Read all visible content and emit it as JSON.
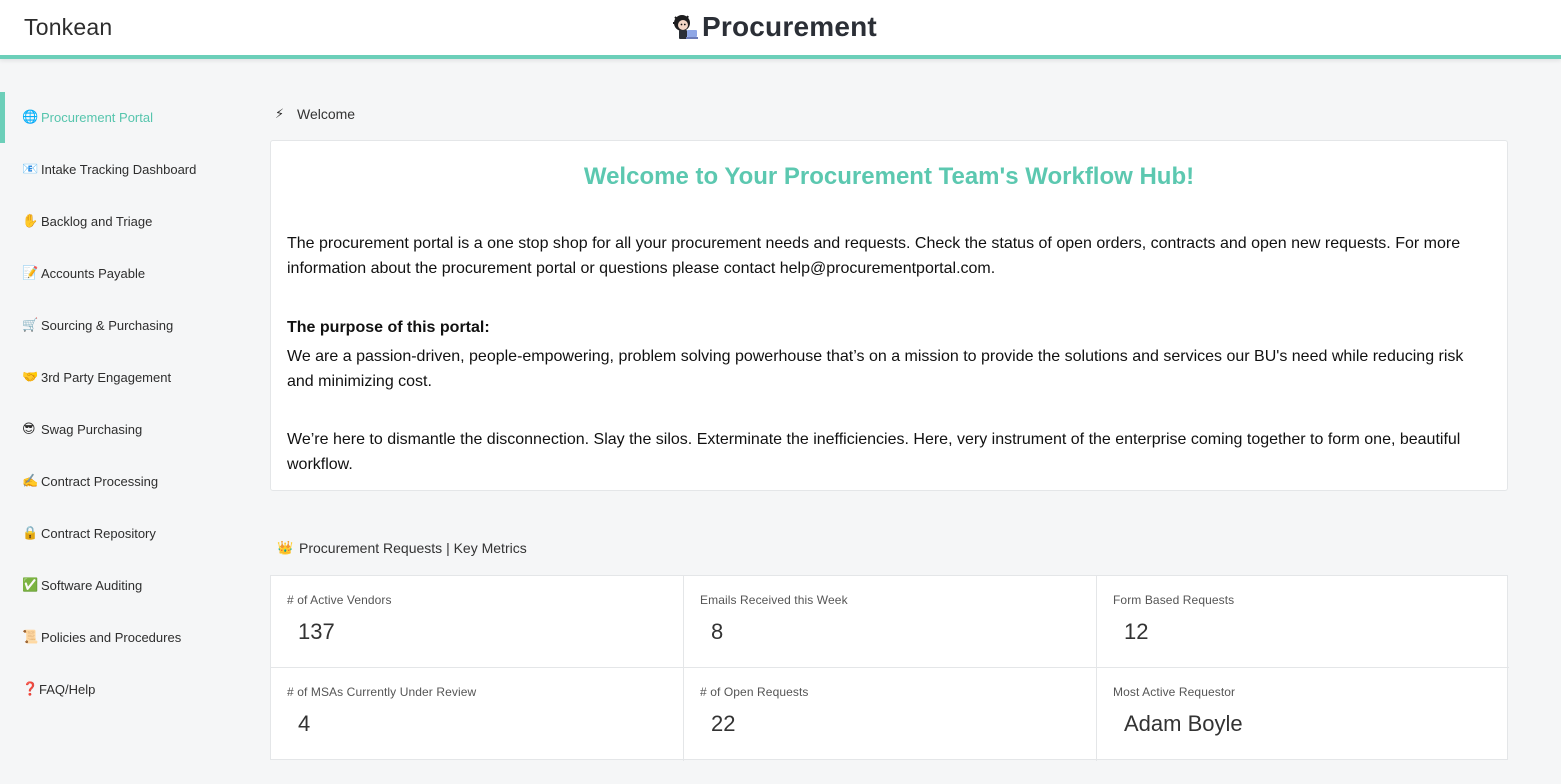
{
  "header": {
    "brand": "Tonkean",
    "app_title": "Procurement"
  },
  "sidebar": {
    "items": [
      {
        "emoji": "🌐",
        "label": "Procurement Portal",
        "active": true
      },
      {
        "emoji": "📧",
        "label": "Intake Tracking Dashboard"
      },
      {
        "emoji": "✋",
        "label": "Backlog and Triage"
      },
      {
        "emoji": "📝",
        "label": "Accounts Payable"
      },
      {
        "emoji": "🛒",
        "label": "Sourcing & Purchasing"
      },
      {
        "emoji": "🤝",
        "label": "3rd Party Engagement"
      },
      {
        "emoji": "😎",
        "label": "Swag Purchasing"
      },
      {
        "emoji": "✍️",
        "label": "Contract Processing"
      },
      {
        "emoji": "🔒",
        "label": "Contract Repository"
      },
      {
        "emoji": "✅",
        "label": "Software Auditing"
      },
      {
        "emoji": "📜",
        "label": "Policies and Procedures"
      },
      {
        "emoji": "❓",
        "label": "FAQ/Help"
      }
    ]
  },
  "welcome_section": {
    "icon": "⚡",
    "title": "Welcome",
    "card_title": "Welcome to Your Procurement Team's Workflow Hub!",
    "paragraph1": "The procurement portal is a one stop shop for all your procurement needs and requests. Check the status of open orders, contracts and open new requests. For more information about the procurement portal or questions please contact help@procurementportal.com.",
    "purpose_heading": "The purpose of this portal:",
    "paragraph2": "We are a passion-driven, people-empowering, problem solving powerhouse that’s on a mission to provide the solutions and services our BU's need while reducing risk and minimizing cost.",
    "paragraph3": "We’re here to dismantle the disconnection. Slay the silos. Exterminate the inefficiencies. Here, very instrument of the enterprise coming together to form one, beautiful workflow."
  },
  "metrics_section": {
    "icon": "👑",
    "title": "Procurement Requests | Key Metrics",
    "metrics": [
      {
        "label": "# of Active Vendors",
        "value": "137"
      },
      {
        "label": "Emails Received this Week",
        "value": "8"
      },
      {
        "label": "Form Based Requests",
        "value": "12"
      },
      {
        "label": "# of MSAs Currently Under Review",
        "value": "4"
      },
      {
        "label": "# of Open Requests",
        "value": "22"
      },
      {
        "label": "Most Active Requestor",
        "value": "Adam Boyle"
      }
    ]
  },
  "colors": {
    "accent": "#6ccfb9",
    "title_green": "#5cc8b0"
  }
}
